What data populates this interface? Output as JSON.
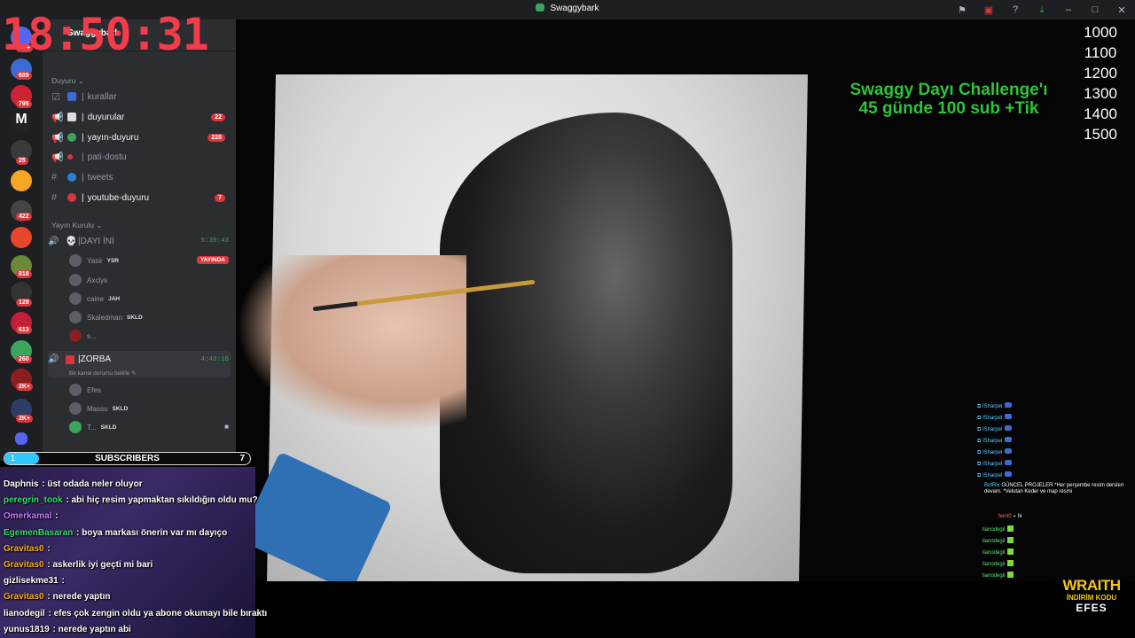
{
  "window": {
    "title": "Swaggybark"
  },
  "clock": "18:50:31",
  "guild_badges": [
    "1K+",
    "689",
    "795",
    "25",
    "422",
    "818",
    "128",
    "613",
    "260",
    "2K+",
    "2K+"
  ],
  "server": {
    "name": "Swaggybark"
  },
  "categories": {
    "announce": "Duyuru",
    "broadcast": "Yayın Kurulu"
  },
  "channels": [
    {
      "name": "kurallar",
      "count": "",
      "color": "#3d6bd4"
    },
    {
      "name": "duyurular",
      "count": "22",
      "color": "#dcdcdc"
    },
    {
      "name": "yayın-duyuru",
      "count": "228",
      "color": "#3ba55c"
    },
    {
      "name": "pati-dostu",
      "count": "",
      "color": "#da373c"
    },
    {
      "name": "tweets",
      "count": "",
      "color": "#2b7fd6"
    },
    {
      "name": "youtube-duyuru",
      "count": "7",
      "color": "#da373c"
    }
  ],
  "voice1": {
    "name": "DAYI İNİ",
    "time": "5:39:43",
    "users": [
      {
        "name": "Yasir",
        "tag": "YSR",
        "live": "YAYINDA"
      },
      {
        "name": "Axclys",
        "tag": ""
      },
      {
        "name": "caine",
        "tag": "JAH"
      },
      {
        "name": "Skaledman",
        "tag": "SKLD"
      },
      {
        "name": "s...",
        "tag": ""
      }
    ]
  },
  "voice2": {
    "name": "ZORBA",
    "time": "4:43:16",
    "status": "Bir kanal durumu belirle",
    "users": [
      {
        "name": "Efes",
        "tag": ""
      },
      {
        "name": "Massu",
        "tag": "SKLD"
      },
      {
        "name": "T...",
        "tag": "SKLD"
      }
    ]
  },
  "subs": {
    "label": "SUBSCRIBERS",
    "current": "1",
    "goal": "7",
    "fraction": 0.14
  },
  "chat": [
    {
      "user": "Daphnis",
      "color": "#ffffff",
      "msg": "üst odada neler oluyor"
    },
    {
      "user": "peregrin_took",
      "color": "#2ee36b",
      "msg": "abi hiç resim yapmaktan sıkıldığın oldu mu?"
    },
    {
      "user": "Omerkamal",
      "color": "#c27cff",
      "msg": ""
    },
    {
      "user": "EgemenBasaran",
      "color": "#2ee36b",
      "msg": "boya markası önerin var mı dayıço"
    },
    {
      "user": "Gravitas0",
      "color": "#ffb21c",
      "msg": ""
    },
    {
      "user": "Gravitas0",
      "color": "#ffb21c",
      "msg": "askerlik iyi geçti mi bari"
    },
    {
      "user": "gizlisekme31",
      "color": "#ffffff",
      "msg": ""
    },
    {
      "user": "Gravitas0",
      "color": "#ffb21c",
      "msg": "nerede yaptın"
    },
    {
      "user": "lianodegil",
      "color": "#ffffff",
      "msg": "efes çok zengin oldu ya abone okumayı bile bıraktı"
    },
    {
      "user": "yunus1819",
      "color": "#ffffff",
      "msg": "nerede yaptın abi"
    }
  ],
  "challenge": {
    "line1": "Swaggy Dayı Challenge'ı",
    "line2": "45 günde 100 sub +Tik"
  },
  "goals": [
    "1000",
    "1100",
    "1200",
    "1300",
    "1400",
    "1500"
  ],
  "right_chat": {
    "sharpel": "ISharpel",
    "botrix_user": "BotRix",
    "botrix_msg": "GÜNCEL PROJELER *Her perşembe resim dersleri devam. *Velutan Keder ve map resmi",
    "feint_user": "feint0",
    "feint_msg": "hi",
    "liano": "lianodegil"
  },
  "sponsor": {
    "brand": "WRAITH",
    "line": "İNDİRİM KODU",
    "code": "EFES"
  }
}
